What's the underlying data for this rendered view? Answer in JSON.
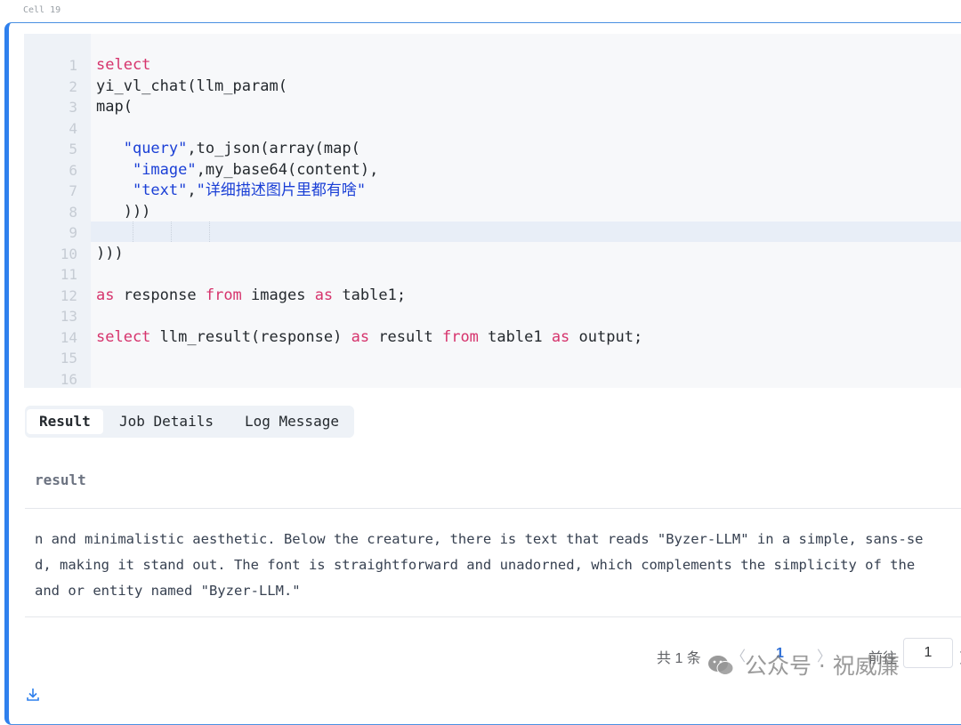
{
  "cell": {
    "label": "Cell 19"
  },
  "editor": {
    "lines": [
      {
        "n": "1",
        "code": [
          {
            "t": "select",
            "c": "kw"
          }
        ]
      },
      {
        "n": "2",
        "code": [
          {
            "t": "yi_vl_chat(llm_param(",
            "c": ""
          }
        ]
      },
      {
        "n": "3",
        "code": [
          {
            "t": "map(",
            "c": ""
          }
        ]
      },
      {
        "n": "4",
        "code": []
      },
      {
        "n": "5",
        "code": [
          {
            "t": "   ",
            "c": ""
          },
          {
            "t": "\"query\"",
            "c": "str"
          },
          {
            "t": ",to_json(array(map(",
            "c": ""
          }
        ]
      },
      {
        "n": "6",
        "code": [
          {
            "t": "    ",
            "c": ""
          },
          {
            "t": "\"image\"",
            "c": "str"
          },
          {
            "t": ",my_base64(content),",
            "c": ""
          }
        ]
      },
      {
        "n": "7",
        "code": [
          {
            "t": "    ",
            "c": ""
          },
          {
            "t": "\"text\"",
            "c": "str"
          },
          {
            "t": ",",
            "c": ""
          },
          {
            "t": "\"详细描述图片里都有啥\"",
            "c": "str"
          }
        ]
      },
      {
        "n": "8",
        "code": [
          {
            "t": "   )))",
            "c": ""
          }
        ]
      },
      {
        "n": "9",
        "code": []
      },
      {
        "n": "10",
        "code": [
          {
            "t": ")))",
            "c": ""
          }
        ]
      },
      {
        "n": "11",
        "code": []
      },
      {
        "n": "12",
        "code": [
          {
            "t": "as",
            "c": "kw"
          },
          {
            "t": " response ",
            "c": ""
          },
          {
            "t": "from",
            "c": "kw"
          },
          {
            "t": " images ",
            "c": ""
          },
          {
            "t": "as",
            "c": "kw"
          },
          {
            "t": " table1;",
            "c": ""
          }
        ]
      },
      {
        "n": "13",
        "code": []
      },
      {
        "n": "14",
        "code": [
          {
            "t": "select",
            "c": "kw"
          },
          {
            "t": " llm_result(response) ",
            "c": ""
          },
          {
            "t": "as",
            "c": "kw"
          },
          {
            "t": " result ",
            "c": ""
          },
          {
            "t": "from",
            "c": "kw"
          },
          {
            "t": " table1 ",
            "c": ""
          },
          {
            "t": "as",
            "c": "kw"
          },
          {
            "t": " output;",
            "c": ""
          }
        ]
      },
      {
        "n": "15",
        "code": []
      },
      {
        "n": "16",
        "code": []
      }
    ]
  },
  "tabs": {
    "result": "Result",
    "job_details": "Job Details",
    "log_message": "Log Message"
  },
  "result_table": {
    "column": "result",
    "lines": [
      "n and minimalistic aesthetic. Below the creature, there is text that reads \"Byzer-LLM\" in a simple, sans-se",
      "d, making it stand out. The font is straightforward and unadorned, which complements the simplicity of the",
      "and or entity named \"Byzer-LLM.\""
    ]
  },
  "pagination": {
    "total_prefix": "共 1 条",
    "prev": "〈",
    "current_page": "1",
    "next": "〉",
    "goto_label": "前往",
    "goto_value": "1",
    "goto_suffix": "页"
  },
  "watermark": {
    "text": "公众号 · 祝威廉"
  },
  "colors": {
    "accent": "#2f80ed",
    "keyword": "#d6336c",
    "string": "#1a3fd6"
  }
}
